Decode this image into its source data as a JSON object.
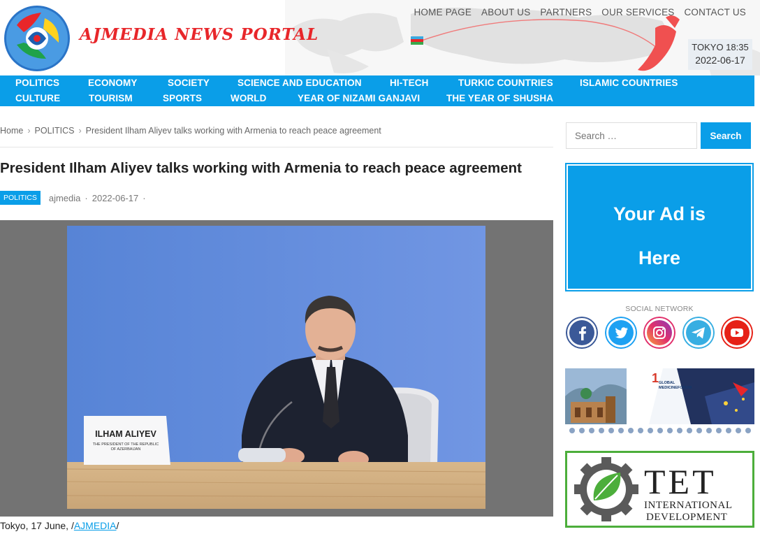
{
  "header": {
    "site_title": "AJMEDIA NEWS PORTAL",
    "top_nav": [
      "HOME PAGE",
      "ABOUT US",
      "PARTNERS",
      "OUR SERVICES",
      "CONTACT US"
    ],
    "clock_city_time": "TOKYO 18:35",
    "clock_date": "2022-06-17"
  },
  "categories": {
    "row1": [
      "POLITICS",
      "ECONOMY",
      "SOCIETY",
      "SCIENCE AND EDUCATION",
      "HI-TECH",
      "TURKIC COUNTRIES",
      "ISLAMIC COUNTRIES"
    ],
    "row2": [
      "CULTURE",
      "TOURISM",
      "SPORTS",
      "WORLD",
      "YEAR OF NIZAMI GANJAVI",
      "THE YEAR OF SHUSHA"
    ]
  },
  "breadcrumb": {
    "home": "Home",
    "section": "POLITICS",
    "current": "President Ilham Aliyev talks working with Armenia to reach peace agreement"
  },
  "article": {
    "title": "President Ilham Aliyev talks working with Armenia to reach peace agreement",
    "category": "POLITICS",
    "author": "ajmedia",
    "date": "2022-06-17",
    "trailing_dot": "·",
    "nameplate_name": "ILHAM ALIYEV",
    "nameplate_role_1": "THE PRESIDENT OF THE REPUBLIC",
    "nameplate_role_2": "OF AZERBAIJAN",
    "caption_prefix": "Tokyo, 17 June, /",
    "caption_link": "AJMEDIA",
    "caption_suffix": "/"
  },
  "sidebar": {
    "search_placeholder": "Search …",
    "search_button": "Search",
    "ad_line1": "Your Ad is",
    "ad_line2": "Here",
    "social_title": "SOCIAL NETWORK",
    "social_icons": [
      "facebook-icon",
      "twitter-icon",
      "instagram-icon",
      "telegram-icon",
      "youtube-icon"
    ],
    "banner1_line1": "GLOBAL",
    "banner1_line2": "MEDICINEFORUM",
    "banner1_number": "1",
    "banner2_brand": "TET",
    "banner2_line1": "INTERNATIONAL",
    "banner2_line2": "DEVELOPMENT"
  },
  "colors": {
    "accent": "#0a9ee8",
    "title_red": "#e8262a",
    "tet_green": "#4cae3b"
  }
}
